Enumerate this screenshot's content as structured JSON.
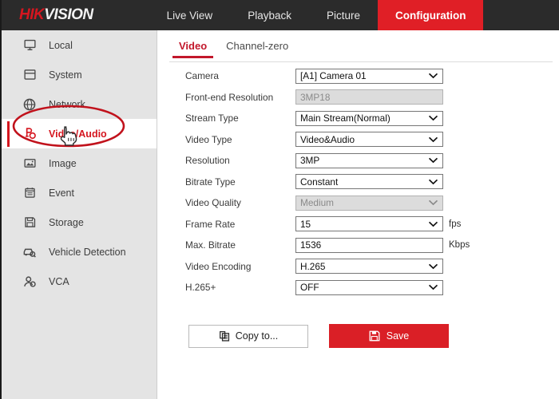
{
  "header": {
    "logo_hik": "HIK",
    "logo_vision": "VISION",
    "tabs": [
      {
        "label": "Live View",
        "active": false
      },
      {
        "label": "Playback",
        "active": false
      },
      {
        "label": "Picture",
        "active": false
      },
      {
        "label": "Configuration",
        "active": true
      }
    ],
    "accent_red": "#e01f26",
    "bar_dark": "#2b2b2b"
  },
  "sidebar": {
    "items": [
      {
        "label": "Local",
        "icon": "monitor-icon",
        "active": false
      },
      {
        "label": "System",
        "icon": "window-icon",
        "active": false
      },
      {
        "label": "Network",
        "icon": "globe-icon",
        "active": false
      },
      {
        "label": "Video/Audio",
        "icon": "video-audio-icon",
        "active": true
      },
      {
        "label": "Image",
        "icon": "image-icon",
        "active": false
      },
      {
        "label": "Event",
        "icon": "calendar-icon",
        "active": false
      },
      {
        "label": "Storage",
        "icon": "floppy-icon",
        "active": false
      },
      {
        "label": "Vehicle Detection",
        "icon": "vehicle-search-icon",
        "active": false
      },
      {
        "label": "VCA",
        "icon": "vca-icon",
        "active": false
      }
    ],
    "active_color": "#d5161f",
    "background": "#e4e4e4"
  },
  "main": {
    "tabs": [
      {
        "label": "Video",
        "active": true
      },
      {
        "label": "Channel-zero",
        "active": false
      }
    ],
    "fields": [
      {
        "label": "Camera",
        "type": "select",
        "value": "[A1] Camera 01",
        "disabled": false,
        "unit": ""
      },
      {
        "label": "Front-end Resolution",
        "type": "text",
        "value": "3MP18",
        "disabled": true,
        "unit": ""
      },
      {
        "label": "Stream Type",
        "type": "select",
        "value": "Main Stream(Normal)",
        "disabled": false,
        "unit": ""
      },
      {
        "label": "Video Type",
        "type": "select",
        "value": "Video&Audio",
        "disabled": false,
        "unit": ""
      },
      {
        "label": "Resolution",
        "type": "select",
        "value": "3MP",
        "disabled": false,
        "unit": ""
      },
      {
        "label": "Bitrate Type",
        "type": "select",
        "value": "Constant",
        "disabled": false,
        "unit": ""
      },
      {
        "label": "Video Quality",
        "type": "select",
        "value": "Medium",
        "disabled": true,
        "unit": ""
      },
      {
        "label": "Frame Rate",
        "type": "select",
        "value": "15",
        "disabled": false,
        "unit": "fps"
      },
      {
        "label": "Max. Bitrate",
        "type": "text",
        "value": "1536",
        "disabled": false,
        "unit": "Kbps"
      },
      {
        "label": "Video Encoding",
        "type": "select",
        "value": "H.265",
        "disabled": false,
        "unit": ""
      },
      {
        "label": "H.265+",
        "type": "select",
        "value": "OFF",
        "disabled": false,
        "unit": ""
      }
    ],
    "buttons": {
      "copy_to": "Copy to...",
      "save": "Save",
      "save_color": "#da1f26"
    }
  },
  "annotation": {
    "ellipse_color": "#c1121c",
    "target": "Video/Audio",
    "cursor": "pointing-hand-cursor"
  }
}
